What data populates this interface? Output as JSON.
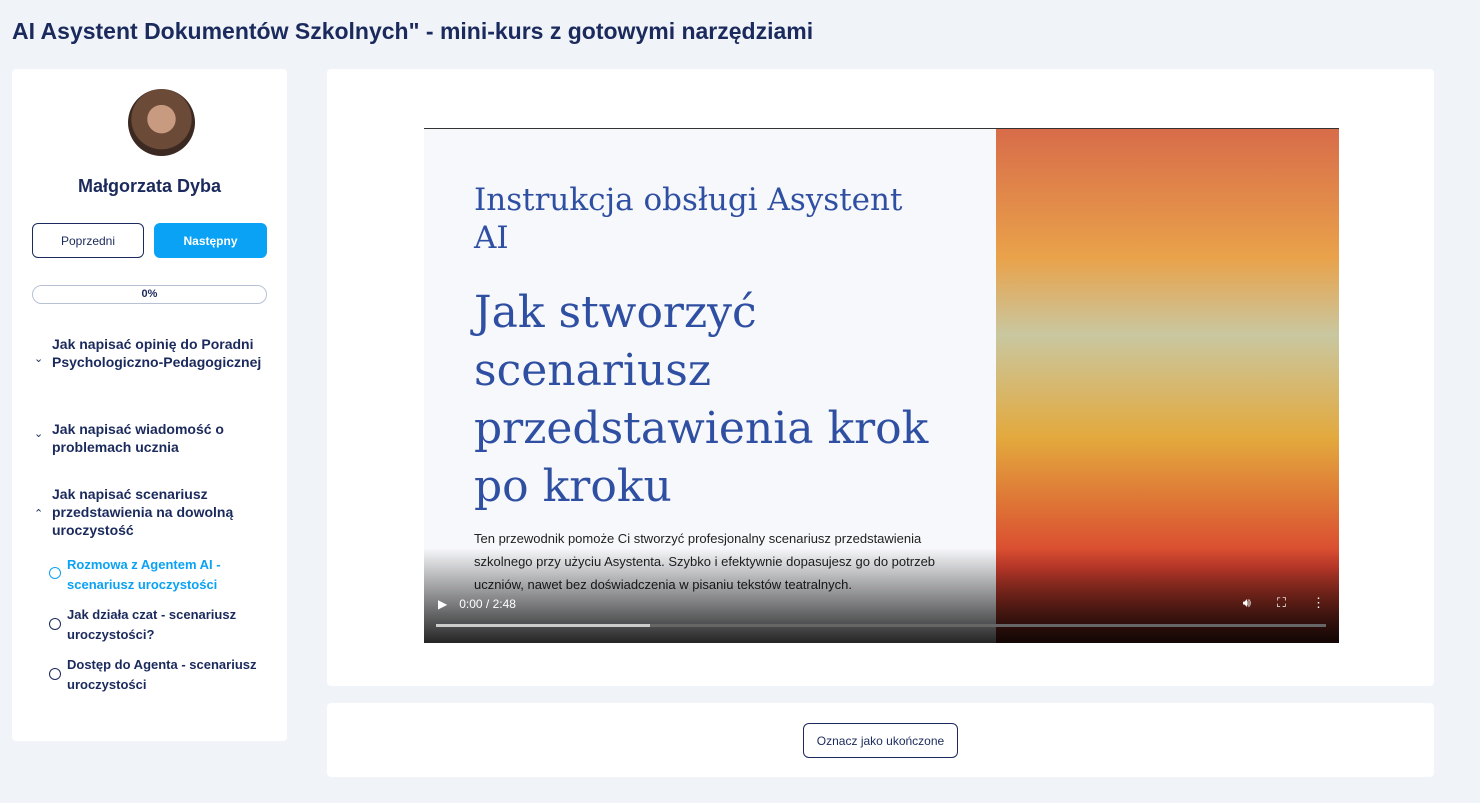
{
  "title": "AI Asystent Dokumentów Szkolnych\" - mini-kurs z gotowymi narzędziami",
  "sidebar": {
    "author": "Małgorzata Dyba",
    "prev": "Poprzedni",
    "next": "Następny",
    "progress": "0%",
    "progress_value": 0,
    "sections": [
      {
        "label": "Jak napisać opinię do Poradni Psychologiczno-Pedagogicznej",
        "expanded": false
      },
      {
        "label": "Jak napisać wiadomość o problemach ucznia",
        "expanded": false
      },
      {
        "label": "Jak napisać scenariusz przedstawienia na dowolną uroczystość",
        "expanded": true
      }
    ],
    "lessons": [
      {
        "label": "Rozmowa z Agentem AI - scenariusz uroczystości",
        "active": true
      },
      {
        "label": "Jak działa czat - scenariusz uroczystości?",
        "active": false
      },
      {
        "label": "Dostęp do Agenta - scenariusz uroczystości",
        "active": false
      }
    ]
  },
  "video": {
    "slide_subtitle": "Instrukcja obsługi Asystent AI",
    "slide_title": "Jak stworzyć scenariusz przedstawienia krok po kroku",
    "slide_text": "Ten przewodnik pomoże Ci stworzyć profesjonalny scenariusz przedstawienia szkolnego przy użyciu Asystenta. Szybko i efektywnie dopasujesz go do potrzeb uczniów, nawet bez doświadczenia w pisaniu tekstów teatralnych.",
    "time": "0:00 / 2:48",
    "buffered_percent": 24
  },
  "mark_complete": "Oznacz jako ukończone",
  "colors": {
    "accent": "#0aa2f5",
    "text": "#1b2a5c",
    "background": "#f0f3f8"
  }
}
